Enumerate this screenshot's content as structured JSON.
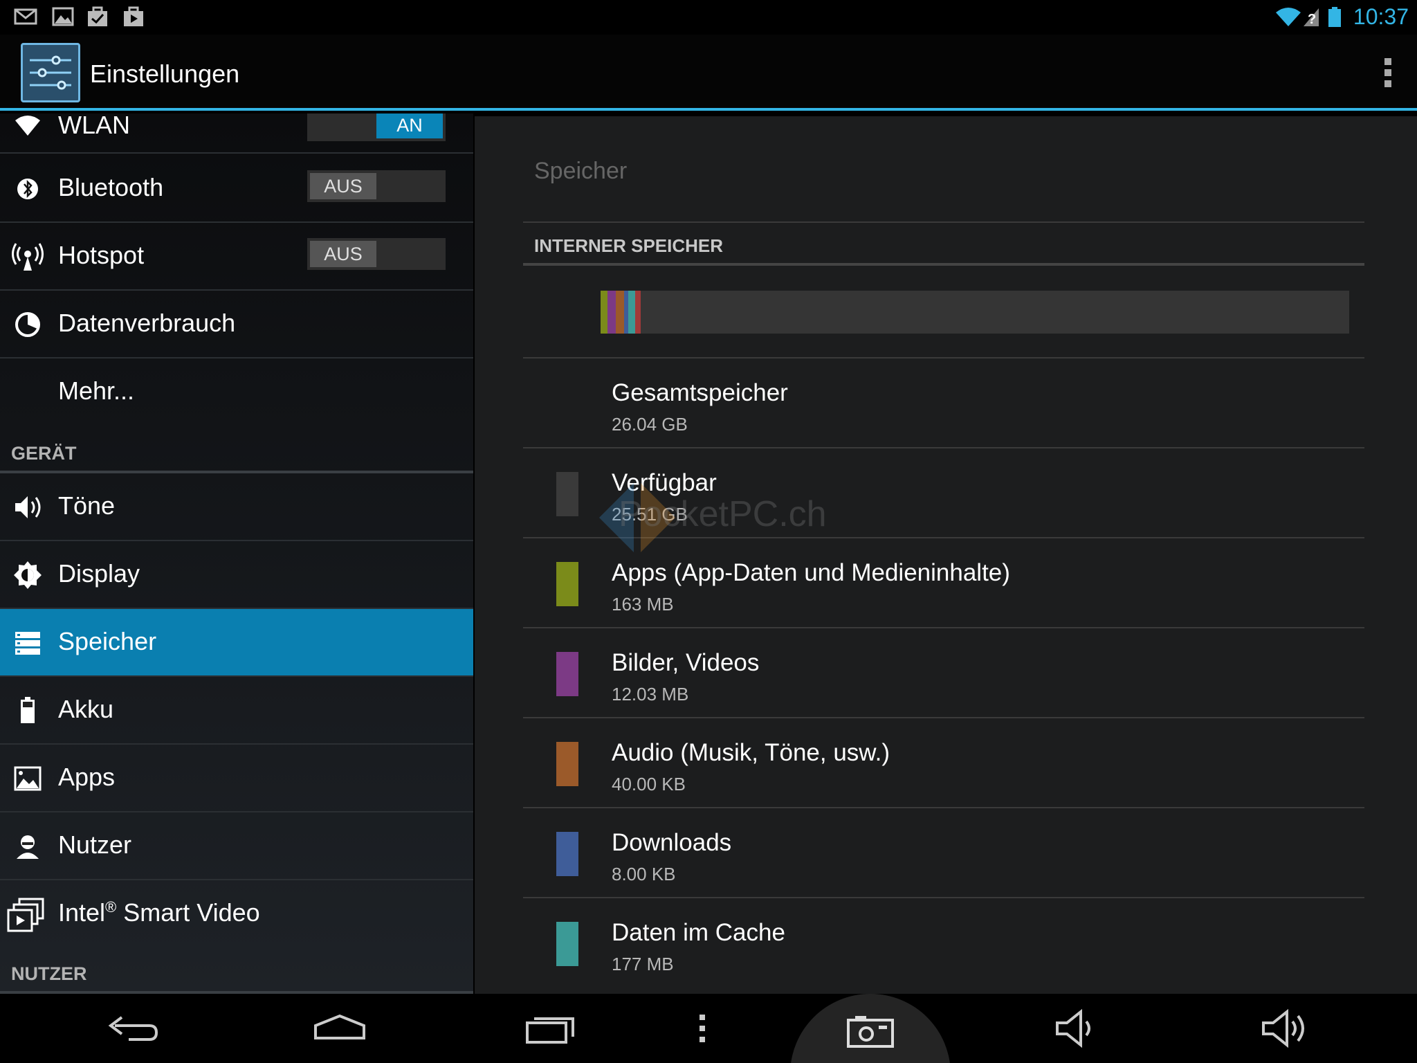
{
  "statusbar": {
    "time": "10:37",
    "left_icons": [
      "gmail-icon",
      "gallery-icon",
      "task-icon",
      "play-store-icon"
    ],
    "right_icons": [
      "wifi-icon",
      "signal-unknown-icon",
      "battery-icon"
    ]
  },
  "actionbar": {
    "title": "Einstellungen",
    "icon": "settings-sliders-icon"
  },
  "sidebar": {
    "items": [
      {
        "label": "WLAN",
        "icon": "wifi-icon",
        "toggle": "AN",
        "toggle_state": "on"
      },
      {
        "label": "Bluetooth",
        "icon": "bluetooth-icon",
        "toggle": "AUS",
        "toggle_state": "off"
      },
      {
        "label": "Hotspot",
        "icon": "hotspot-icon",
        "toggle": "AUS",
        "toggle_state": "off"
      },
      {
        "label": "Datenverbrauch",
        "icon": "data-usage-icon"
      },
      {
        "label": "Mehr...",
        "icon": ""
      }
    ],
    "section_device": "GERÄT",
    "device_items": [
      {
        "label": "Töne",
        "icon": "sound-icon"
      },
      {
        "label": "Display",
        "icon": "brightness-icon"
      },
      {
        "label": "Speicher",
        "icon": "storage-icon",
        "selected": true
      },
      {
        "label": "Akku",
        "icon": "battery-icon"
      },
      {
        "label": "Apps",
        "icon": "apps-icon"
      },
      {
        "label": "Nutzer",
        "icon": "user-icon"
      },
      {
        "label": "Intel",
        "label_sup": "®",
        "label_rest": " Smart Video",
        "icon": "smart-video-icon"
      }
    ],
    "section_user": "NUTZER"
  },
  "main": {
    "title": "Speicher",
    "section": "INTERNER SPEICHER",
    "usage_segments": [
      {
        "name": "Apps",
        "color": "#7b8b1a"
      },
      {
        "name": "Bilder, Videos",
        "color": "#7c3a85"
      },
      {
        "name": "Audio",
        "color": "#9b5a2a"
      },
      {
        "name": "Downloads",
        "color": "#3f5d99"
      },
      {
        "name": "Cache",
        "color": "#3b9a96"
      },
      {
        "name": "Misc",
        "color": "#a13a3a"
      }
    ],
    "rows": [
      {
        "title": "Gesamtspeicher",
        "value": "26.04 GB",
        "color": ""
      },
      {
        "title": "Verfügbar",
        "value": "25.51 GB",
        "color": "#3a3a3a"
      },
      {
        "title": "Apps (App-Daten und Medieninhalte)",
        "value": "163 MB",
        "color": "#7b8b1a"
      },
      {
        "title": "Bilder, Videos",
        "value": "12.03 MB",
        "color": "#7c3a85"
      },
      {
        "title": "Audio (Musik, Töne, usw.)",
        "value": "40.00 KB",
        "color": "#9b5a2a"
      },
      {
        "title": "Downloads",
        "value": "8.00 KB",
        "color": "#3f5d99"
      },
      {
        "title": "Daten im Cache",
        "value": "177 MB",
        "color": "#3b9a96"
      }
    ],
    "watermark": "PocketPC.ch"
  },
  "navbar": {
    "buttons": [
      "back-icon",
      "home-icon",
      "recents-icon",
      "menu-icon",
      "screenshot-icon",
      "volume-down-icon",
      "volume-up-icon"
    ]
  },
  "colors": {
    "accent": "#33b5e5",
    "selected": "#0a7fb0"
  }
}
